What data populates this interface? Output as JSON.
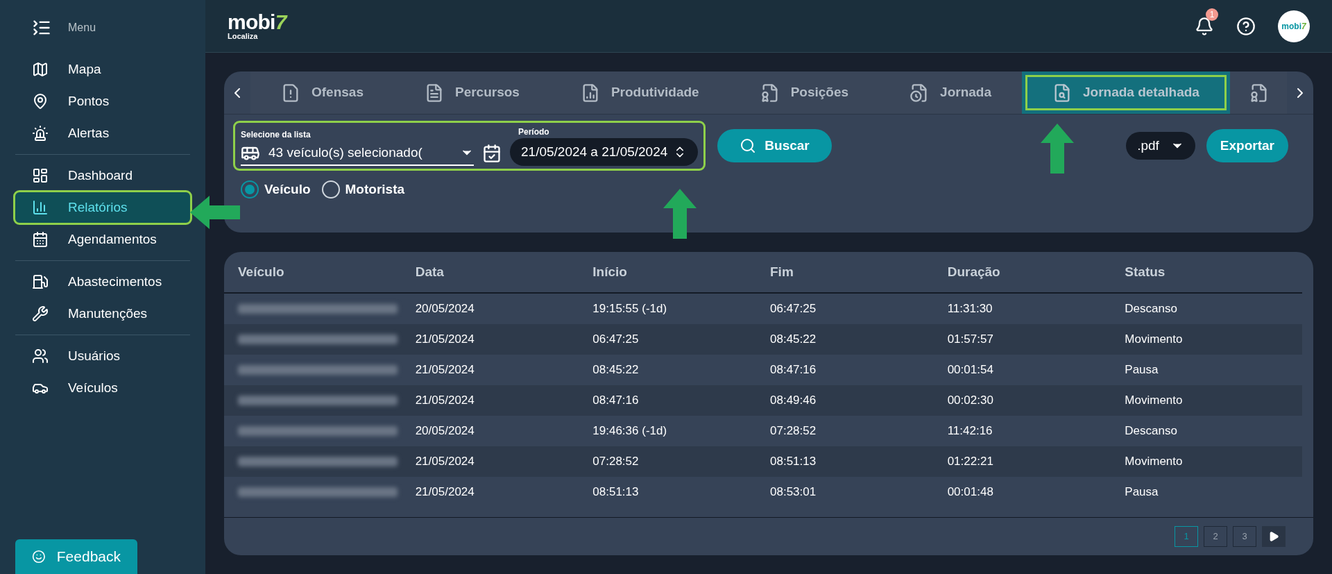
{
  "sidebar": {
    "menu_label": "Menu",
    "groups": [
      [
        {
          "label": "Mapa",
          "selected": false,
          "highlighted": false
        },
        {
          "label": "Pontos",
          "selected": false,
          "highlighted": false
        },
        {
          "label": "Alertas",
          "selected": false,
          "highlighted": false
        }
      ],
      [
        {
          "label": "Dashboard",
          "selected": false,
          "highlighted": false
        },
        {
          "label": "Relatórios",
          "selected": true,
          "highlighted": true
        },
        {
          "label": "Agendamentos",
          "selected": false,
          "highlighted": false
        }
      ],
      [
        {
          "label": "Abastecimentos",
          "selected": false,
          "highlighted": false
        },
        {
          "label": "Manutenções",
          "selected": false,
          "highlighted": false
        }
      ],
      [
        {
          "label": "Usuários",
          "selected": false,
          "highlighted": false
        },
        {
          "label": "Veículos",
          "selected": false,
          "highlighted": false
        }
      ]
    ],
    "feedback": "Feedback"
  },
  "header": {
    "logo": "mobi",
    "logo_mark": "7",
    "logo_sub": "Localiza",
    "notifications": "1",
    "avatar_logo": "mobi",
    "avatar_mark": "7"
  },
  "tabs": [
    {
      "label": "Ofensas",
      "selected": false,
      "highlighted": false
    },
    {
      "label": "Percursos",
      "selected": false,
      "highlighted": false
    },
    {
      "label": "Produtividade",
      "selected": false,
      "highlighted": false
    },
    {
      "label": "Posições",
      "selected": false,
      "highlighted": false
    },
    {
      "label": "Jornada",
      "selected": false,
      "highlighted": false
    },
    {
      "label": "Jornada detalhada",
      "selected": true,
      "highlighted": true
    }
  ],
  "filters": {
    "highlighted": true,
    "vehicle_label": "Selecione da lista",
    "vehicle_value": "43 veículo(s) selecionado(",
    "period_label": "Período",
    "period_value": "21/05/2024 a 21/05/2024",
    "search_button": "Buscar",
    "radios": [
      {
        "label": "Veículo",
        "selected": true
      },
      {
        "label": "Motorista",
        "selected": false
      }
    ],
    "format": ".pdf",
    "export_button": "Exportar"
  },
  "table": {
    "columns": [
      "Veículo",
      "Data",
      "Início",
      "Fim",
      "Duração",
      "Status"
    ],
    "rows": [
      [
        "",
        "20/05/2024",
        "19:15:55 (-1d)",
        "06:47:25",
        "11:31:30",
        "Descanso"
      ],
      [
        "",
        "21/05/2024",
        "06:47:25",
        "08:45:22",
        "01:57:57",
        "Movimento"
      ],
      [
        "",
        "21/05/2024",
        "08:45:22",
        "08:47:16",
        "00:01:54",
        "Pausa"
      ],
      [
        "",
        "21/05/2024",
        "08:47:16",
        "08:49:46",
        "00:02:30",
        "Movimento"
      ],
      [
        "",
        "20/05/2024",
        "19:46:36 (-1d)",
        "07:28:52",
        "11:42:16",
        "Descanso"
      ],
      [
        "",
        "21/05/2024",
        "07:28:52",
        "08:51:13",
        "01:22:21",
        "Movimento"
      ],
      [
        "",
        "21/05/2024",
        "08:51:13",
        "08:53:01",
        "00:01:48",
        "Pausa"
      ]
    ],
    "pages": [
      {
        "label": "1",
        "selected": true
      },
      {
        "label": "2",
        "selected": false
      },
      {
        "label": "3",
        "selected": false
      }
    ]
  }
}
